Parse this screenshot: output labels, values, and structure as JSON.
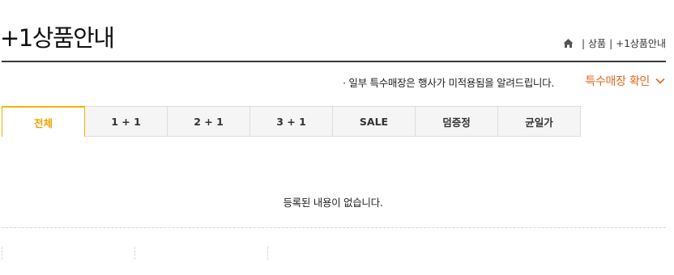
{
  "page": {
    "title": "+1상품안내"
  },
  "breadcrumb": {
    "home_icon": "home-icon",
    "items": [
      "상품",
      "+1상품안내"
    ],
    "separator": "|"
  },
  "notice": {
    "text": "· 일부 특수매장은 행사가 미적용됨을 알려드립니다."
  },
  "store_check": {
    "label": "특수매장 확인",
    "icon": "chevron-down-icon",
    "color": "#e0691d"
  },
  "tabs": [
    {
      "label": "전체",
      "active": true
    },
    {
      "label": "1 + 1",
      "active": false
    },
    {
      "label": "2 + 1",
      "active": false
    },
    {
      "label": "3 + 1",
      "active": false
    },
    {
      "label": "SALE",
      "active": false
    },
    {
      "label": "덤증정",
      "active": false
    },
    {
      "label": "균일가",
      "active": false
    }
  ],
  "colors": {
    "accent": "#f3b300",
    "tab_bg": "#f5f5f5"
  },
  "empty": {
    "message": "등록된 내용이 없습니다."
  }
}
